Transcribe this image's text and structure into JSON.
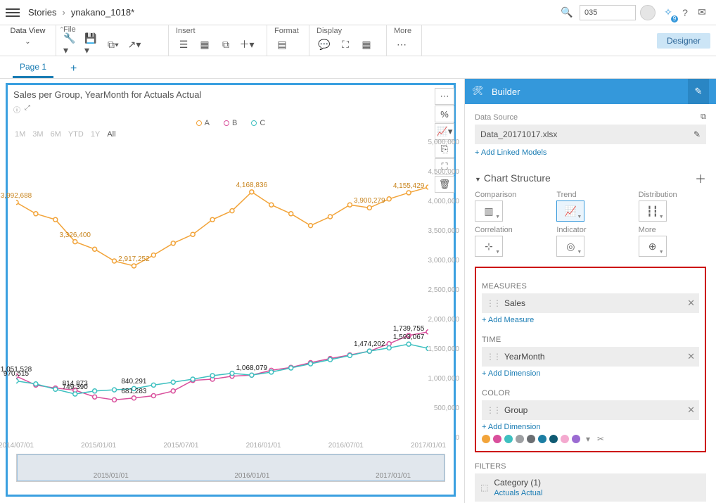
{
  "breadcrumb": {
    "root": "Stories",
    "current": "ynakano_1018*"
  },
  "topbar": {
    "search_id": "035"
  },
  "toolbar": {
    "data_view": "Data View",
    "groups": {
      "file": "File",
      "insert": "Insert",
      "format": "Format",
      "display": "Display",
      "more": "More"
    },
    "designer": "Designer"
  },
  "tabs": {
    "page1": "Page 1"
  },
  "chart": {
    "title": "Sales per Group, YearMonth for Actuals Actual",
    "toolbar_percent": "%",
    "legend": {
      "a": "A",
      "b": "B",
      "c": "C"
    },
    "ranges": [
      "1M",
      "3M",
      "6M",
      "YTD",
      "1Y",
      "All"
    ]
  },
  "chart_data": {
    "type": "line",
    "title": "Sales per Group, YearMonth for Actuals Actual",
    "xlabel": "",
    "ylabel": "",
    "ylim": [
      0,
      5000000
    ],
    "yticks": [
      0,
      500000,
      1000000,
      1500000,
      2000000,
      2500000,
      3000000,
      3500000,
      4000000,
      4500000,
      5000000
    ],
    "ytick_labels": [
      "0",
      "500,000",
      "1,000,000",
      "1,500,000",
      "2,000,000",
      "2,500,000",
      "3,000,000",
      "3,500,000",
      "4,000,000",
      "4,500,000",
      "5,000,000"
    ],
    "x": [
      "2014/07/01",
      "2015/01/01",
      "2015/07/01",
      "2016/01/01",
      "2016/07/01",
      "2017/01/01"
    ],
    "series": [
      {
        "name": "A",
        "color": "#f2a43a",
        "values": [
          3992688,
          3800000,
          3700000,
          3326400,
          3200000,
          3000000,
          2917252,
          3100000,
          3300000,
          3450000,
          3700000,
          3850000,
          4168836,
          3950000,
          3800000,
          3600000,
          3750000,
          3950000,
          3900279,
          4050000,
          4155429,
          4250000
        ],
        "labels": {
          "0": "3,992,688",
          "3": "3,326,400",
          "6": "2,917,252",
          "12": "4,168,836",
          "18": "3,900,279",
          "20": "4,155,429"
        }
      },
      {
        "name": "B",
        "color": "#d94f9c",
        "values": [
          1051528,
          900000,
          850000,
          814873,
          700000,
          650000,
          681283,
          720000,
          800000,
          980000,
          1000000,
          1050000,
          1068079,
          1150000,
          1200000,
          1280000,
          1350000,
          1410000,
          1474202,
          1600000,
          1739755,
          1800000
        ],
        "labels": {
          "0": "1,051,528",
          "3": "814,873",
          "6": "681,283",
          "12": "1,068,079",
          "18": "1,474,202",
          "20": "1,739,755"
        }
      },
      {
        "name": "C",
        "color": "#3ec0c0",
        "values": [
          970515,
          920000,
          830000,
          749390,
          800000,
          820000,
          840291,
          900000,
          950000,
          1000000,
          1060000,
          1100000,
          1068079,
          1120000,
          1190000,
          1260000,
          1330000,
          1400000,
          1474202,
          1530000,
          1593067,
          1520000
        ],
        "labels": {
          "0": "970,515",
          "3": "749,390",
          "6": "840,291",
          "20": "1,593,067"
        }
      }
    ],
    "scrubber_ticks": [
      "2015/01/01",
      "2016/01/01",
      "2017/01/01"
    ]
  },
  "builder": {
    "title": "Builder",
    "data_source_label": "Data Source",
    "data_source": "Data_20171017.xlsx",
    "add_linked": "+ Add Linked Models",
    "structure_title": "Chart Structure",
    "types": {
      "comparison": "Comparison",
      "trend": "Trend",
      "distribution": "Distribution",
      "correlation": "Correlation",
      "indicator": "Indicator",
      "more": "More"
    },
    "measures_label": "MEASURES",
    "measures_value": "Sales",
    "add_measure": "+ Add Measure",
    "time_label": "TIME",
    "time_value": "YearMonth",
    "add_time": "+ Add Dimension",
    "color_label": "COLOR",
    "color_value": "Group",
    "add_color": "+ Add Dimension",
    "palette": [
      "#f2a43a",
      "#d94f9c",
      "#3ec0c0",
      "#9ea0a3",
      "#6b6e72",
      "#1c7ea3",
      "#0f5a72",
      "#f4a9cf",
      "#9b6bd2"
    ],
    "filters_label": "FILTERS",
    "filter_name": "Category (1)",
    "filter_value": "Actuals Actual"
  }
}
